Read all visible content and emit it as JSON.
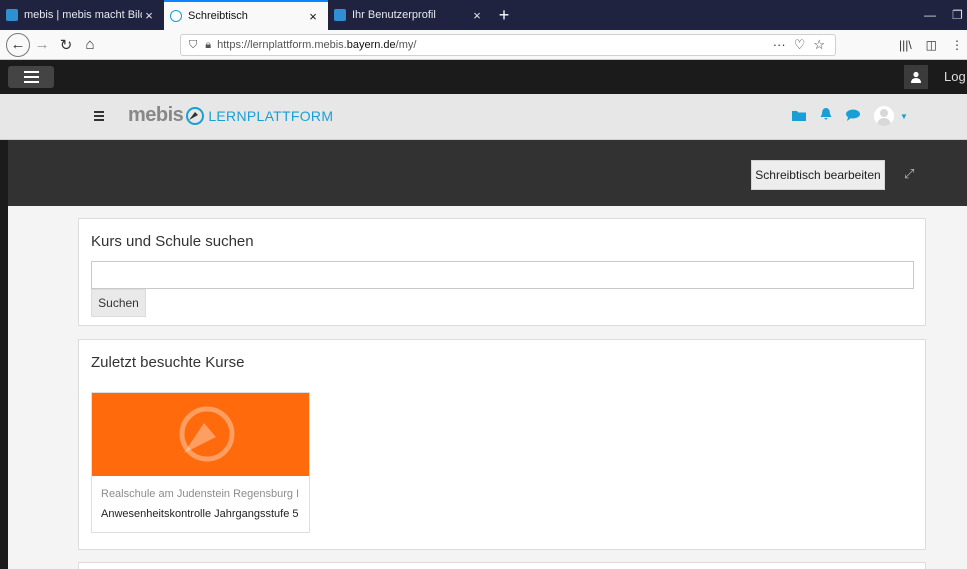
{
  "browser": {
    "tabs": [
      {
        "title": "mebis | mebis macht Bildung d",
        "active": false,
        "icon": "mebis-favicon"
      },
      {
        "title": "Schreibtisch",
        "active": true,
        "icon": "mebis-logo-favicon"
      },
      {
        "title": "Ihr Benutzerprofil",
        "active": false,
        "icon": "mebis-favicon"
      }
    ],
    "close_glyph": "×",
    "new_tab_glyph": "+",
    "url_prefix": "https://lernplattform.mebis.",
    "url_domain": "bayern.de",
    "url_suffix": "/my/"
  },
  "site": {
    "login_text": "Log"
  },
  "mebis": {
    "logo_word": "mebis",
    "logo_suffix": "LERNPLATTFORM",
    "accent_color": "#1a9fd5"
  },
  "dashboard": {
    "edit_button": "Schreibtisch bearbeiten"
  },
  "search_block": {
    "title": "Kurs und Schule suchen",
    "input_value": "",
    "button": "Suchen"
  },
  "recent_block": {
    "title": "Zuletzt besuchte Kurse",
    "courses": [
      {
        "category": "Realschule am Judenstein Regensburg I",
        "name": "Anwesenheitskontrolle Jahrgangsstufe 5",
        "color": "#ff6a0d"
      }
    ]
  }
}
